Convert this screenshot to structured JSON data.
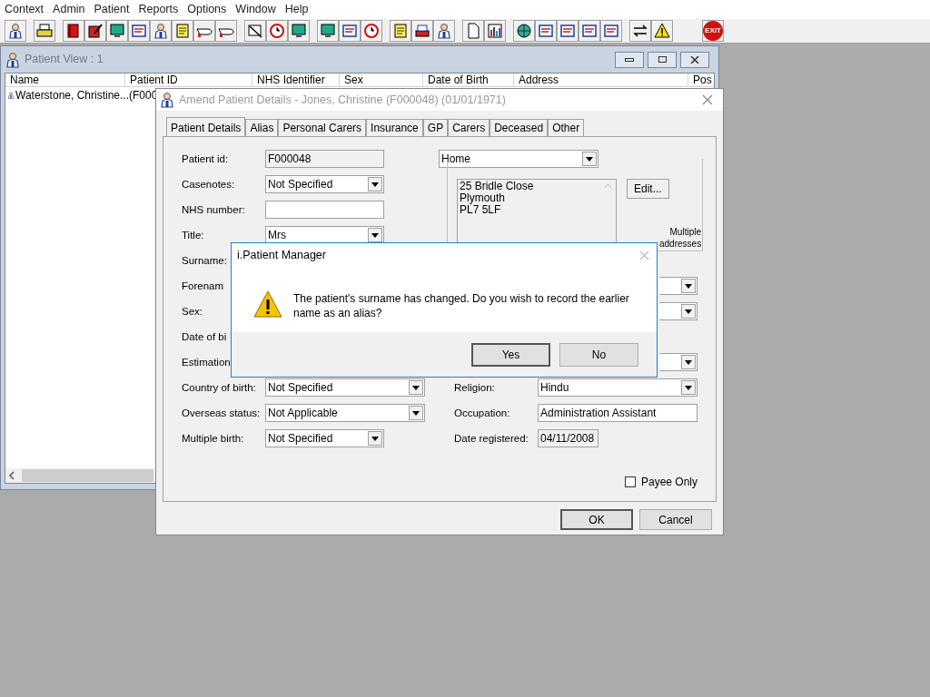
{
  "menu": [
    "Context",
    "Admin",
    "Patient",
    "Reports",
    "Options",
    "Window",
    "Help"
  ],
  "toolbar": {
    "exit_label": "EXIT"
  },
  "patient_view": {
    "title": "Patient View : 1",
    "columns": [
      "Name",
      "Patient ID",
      "NHS Identifier",
      "Sex",
      "Date of Birth",
      "Address",
      "Pos"
    ],
    "rows": [
      {
        "name": "Waterstone, Christine...",
        "patient_id": "(F000"
      }
    ]
  },
  "amend": {
    "title": "Amend Patient Details - Jones, Christine (F000048) (01/01/1971)",
    "tabs": [
      {
        "label": "Patient Details",
        "selected": true
      },
      {
        "label": "Alias",
        "selected": false
      },
      {
        "label": "Personal Carers",
        "selected": false
      },
      {
        "label": "Insurance",
        "selected": false
      },
      {
        "label": "GP",
        "selected": false
      },
      {
        "label": "Carers",
        "selected": false
      },
      {
        "label": "Deceased",
        "selected": false
      },
      {
        "label": "Other",
        "selected": false
      }
    ],
    "left_fields": [
      {
        "label": "Patient id:",
        "kind": "readonly",
        "value": "F000048"
      },
      {
        "label": "Casenotes:",
        "kind": "dropdown",
        "value": "Not Specified"
      },
      {
        "label": "NHS number:",
        "kind": "text"
      },
      {
        "label": "Title:",
        "kind": "dropdown",
        "value": "Mrs"
      },
      {
        "label": "Surname:",
        "kind": "covered"
      },
      {
        "label": "Forenam",
        "kind": "covered"
      },
      {
        "label": "Sex:",
        "kind": "covered"
      },
      {
        "label": "Date of bi",
        "kind": "covered"
      },
      {
        "label": "Estimation",
        "kind": "covered"
      },
      {
        "label": "Country of birth:",
        "kind": "wide_dropdown",
        "value": "Not Specified"
      },
      {
        "label": "Overseas status:",
        "kind": "wide_dropdown",
        "value": "Not Applicable"
      },
      {
        "label": "Multiple birth:",
        "kind": "dropdown",
        "value": "Not Specified"
      }
    ],
    "address": {
      "type": "Home",
      "lines": [
        "25 Bridle Close",
        "Plymouth",
        "PL7 5LF"
      ],
      "edit_button": "Edit...",
      "multiple_label": "Multiple addresses"
    },
    "right_fields": [
      {
        "kind": "covered_dropdown"
      },
      {
        "kind": "covered_dropdown"
      },
      {
        "kind": "blank"
      },
      {
        "kind": "covered_dropdown"
      },
      {
        "label": "Religion:",
        "kind": "dropdown",
        "value": "Hindu"
      },
      {
        "label": "Occupation:",
        "kind": "text",
        "value": "Administration Assistant"
      },
      {
        "label": "Date registered:",
        "kind": "readonly",
        "value": "04/11/2008"
      }
    ],
    "payee_only": {
      "label": "Payee Only",
      "checked": false
    },
    "buttons": [
      "OK",
      "Cancel"
    ]
  },
  "message_box": {
    "title": "i.Patient Manager",
    "text": "The patient's surname has changed.  Do you wish to record the earlier name as an alias?",
    "buttons": [
      "Yes",
      "No"
    ]
  }
}
